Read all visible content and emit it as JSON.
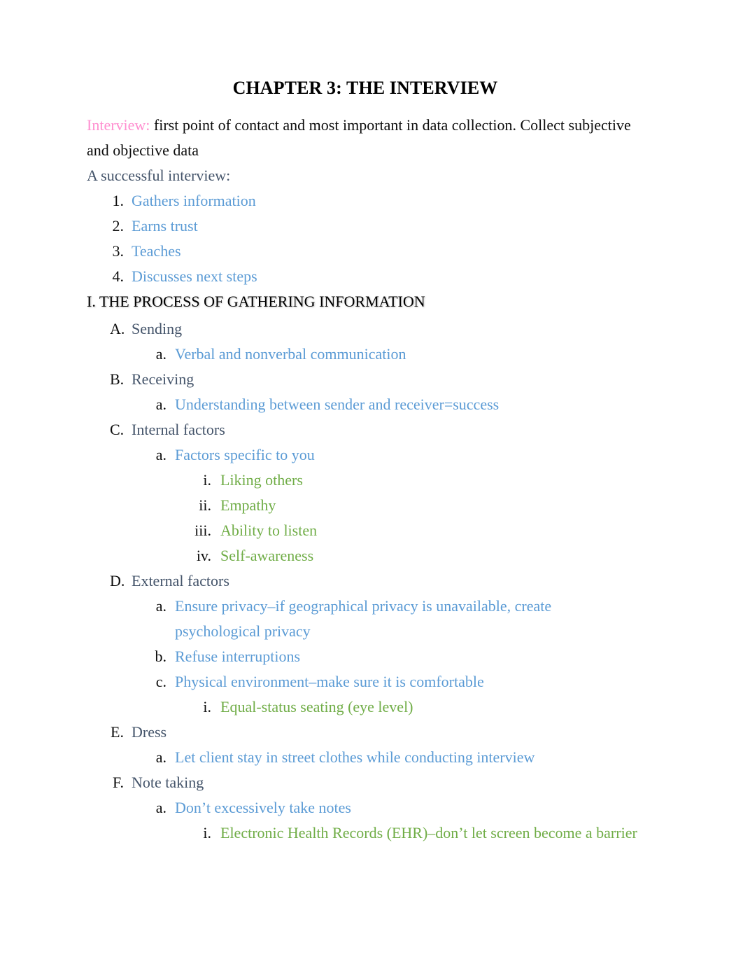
{
  "document": {
    "title": "CHAPTER 3: THE INTERVIEW",
    "lead": {
      "term": "Interview:",
      "body": " first point of contact and most important in data collection. Collect subjective and objective data"
    },
    "intro_line": "A successful interview:",
    "success_list": [
      {
        "marker": "1.",
        "text": "Gathers information"
      },
      {
        "marker": "2.",
        "text": "Earns trust"
      },
      {
        "marker": "3.",
        "text": "Teaches"
      },
      {
        "marker": "4.",
        "text": "Discusses next steps"
      }
    ],
    "section": {
      "heading": "I. THE PROCESS OF GATHERING INFORMATION",
      "items": [
        {
          "marker": "A.",
          "text": "Sending"
        },
        {
          "marker": "a.",
          "text": "Verbal and nonverbal communication"
        },
        {
          "marker": "B.",
          "text": "Receiving"
        },
        {
          "marker": "a.",
          "text": "Understanding between sender and receiver=success"
        },
        {
          "marker": "C.",
          "text": "Internal factors"
        },
        {
          "marker": "a.",
          "text": "Factors specific to you"
        },
        {
          "marker": "i.",
          "text": "Liking others"
        },
        {
          "marker": "ii.",
          "text": "Empathy"
        },
        {
          "marker": "iii.",
          "text": "Ability to listen"
        },
        {
          "marker": "iv.",
          "text": "Self-awareness"
        },
        {
          "marker": "D.",
          "text": "External factors"
        },
        {
          "marker": "a.",
          "text": "Ensure privacy–if geographical privacy is unavailable, create psychological privacy"
        },
        {
          "marker": "b.",
          "text": "Refuse interruptions"
        },
        {
          "marker": "c.",
          "text": "Physical environment–make sure it is comfortable"
        },
        {
          "marker": "i.",
          "text": "Equal-status seating (eye level)"
        },
        {
          "marker": "E.",
          "text": "Dress"
        },
        {
          "marker": "a.",
          "text": "Let client stay in street clothes while conducting interview"
        },
        {
          "marker": "F.",
          "text": "Note taking"
        },
        {
          "marker": "a.",
          "text": "Don’t excessively take notes"
        },
        {
          "marker": "i.",
          "text": "Electronic Health Records (EHR)–don’t let screen become a barrier"
        }
      ]
    },
    "colors": {
      "title": "#000000",
      "body": "#0d0d0d",
      "pink_term": "#ff8fd0",
      "slate_level_a": "#44546a",
      "blue_level_b": "#5b9bd5",
      "green_level_c": "#70ad47",
      "page_background": "#ffffff"
    }
  }
}
